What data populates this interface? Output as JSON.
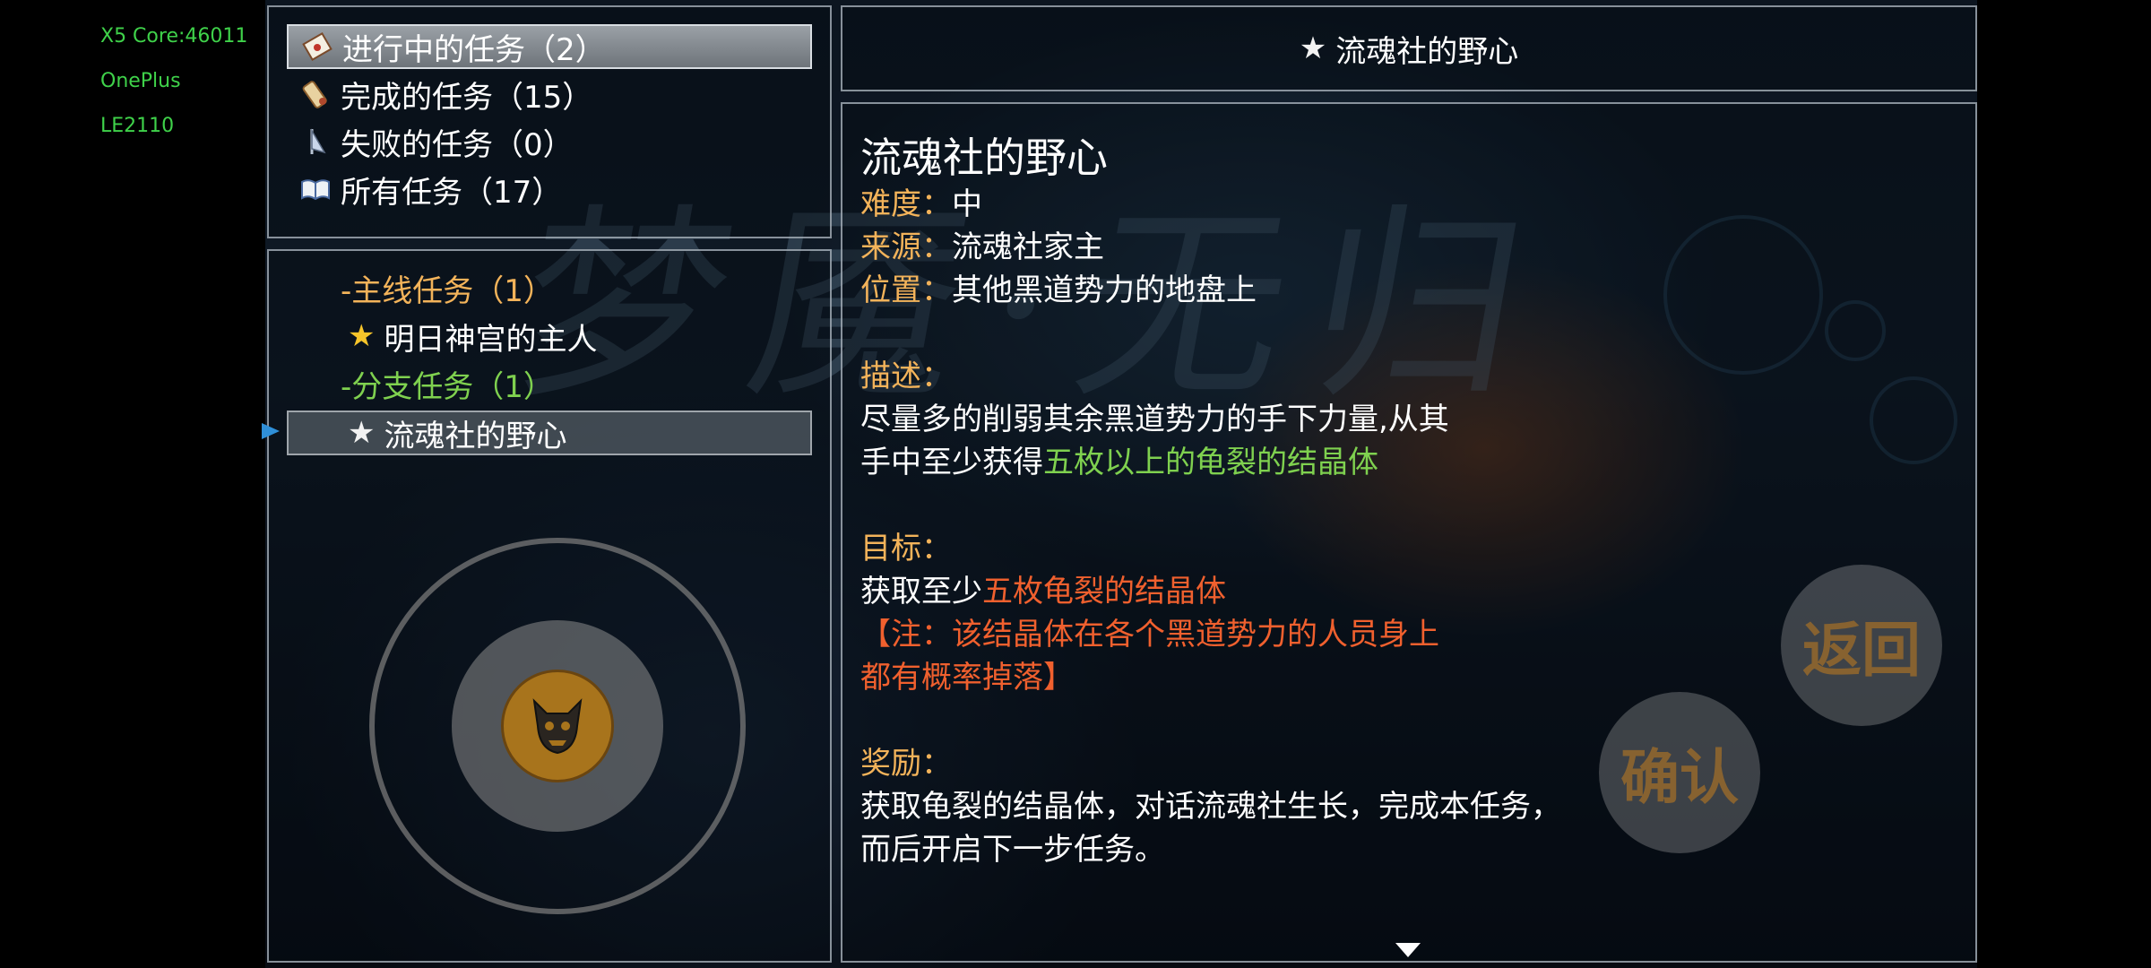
{
  "debug": {
    "core": "X5 Core:46011",
    "brand": "OnePlus",
    "model": "LE2110"
  },
  "background_title": "梦魇·无归",
  "categories": [
    {
      "label": "进行中的任务（2）",
      "icon": "letter-icon",
      "selected": true
    },
    {
      "label": "完成的任务（15）",
      "icon": "scroll-icon",
      "selected": false
    },
    {
      "label": "失败的任务（0）",
      "icon": "flag-icon",
      "selected": false
    },
    {
      "label": "所有任务（17）",
      "icon": "book-icon",
      "selected": false
    }
  ],
  "quest_list": {
    "main_group": "-主线任务（1）",
    "main_quest": "明日神宫的主人",
    "side_group": "-分支任务（1）",
    "side_quest": "流魂社的野心"
  },
  "header_title": "流魂社的野心",
  "detail": {
    "title": "流魂社的野心",
    "difficulty_label": "难度：",
    "difficulty": "中",
    "source_label": "来源：",
    "source": "流魂社家主",
    "location_label": "位置：",
    "location": "其他黑道势力的地盘上",
    "desc_label": "描述：",
    "desc_line1": "尽量多的削弱其余黑道势力的手下力量,从其",
    "desc_line2_prefix": "手中至少获得",
    "desc_line2_highlight": "五枚以上的龟裂的结晶体",
    "goal_label": "目标：",
    "goal_prefix": "获取至少",
    "goal_highlight": "五枚龟裂的结晶体",
    "note_line1": "【注：该结晶体在各个黑道势力的人员身上",
    "note_line2": "都有概率掉落】",
    "reward_label": "奖励：",
    "reward_line1": "获取龟裂的结晶体，对话流魂社生长，完成本任务，",
    "reward_line2": "而后开启下一步任务。"
  },
  "buttons": {
    "back": "返回",
    "confirm": "确认"
  },
  "colors": {
    "label": "#f3b35a",
    "green": "#7fd14f",
    "orange": "#f0602e",
    "debug": "#3fd24a"
  }
}
